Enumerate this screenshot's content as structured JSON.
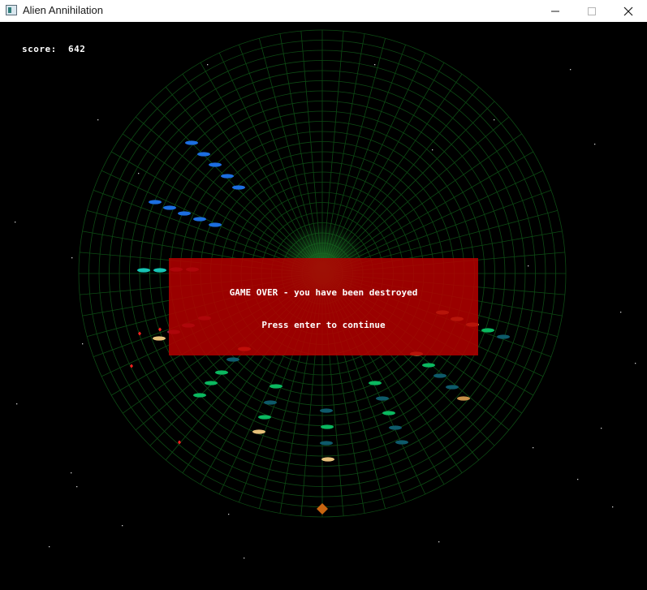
{
  "window": {
    "title": "Alien Annihilation",
    "controls": [
      "minimize",
      "maximize",
      "close"
    ]
  },
  "hud": {
    "score_label": "score:  642"
  },
  "game_over": {
    "title": "GAME OVER - you have been destroyed",
    "prompt": "Press enter to continue",
    "panel_color": "#b40000"
  },
  "playfield": {
    "grid_color": "#0d4a14",
    "background": "#000000",
    "ship_color": "#c86410",
    "enemy_colors": [
      "#1c6ee0",
      "#17c4b4",
      "#0bb860",
      "#0e5a6a",
      "#e6c07a",
      "#c89048",
      "#ff5a3c",
      "#8a2a4a"
    ],
    "projectile_color": "#ff2020"
  }
}
